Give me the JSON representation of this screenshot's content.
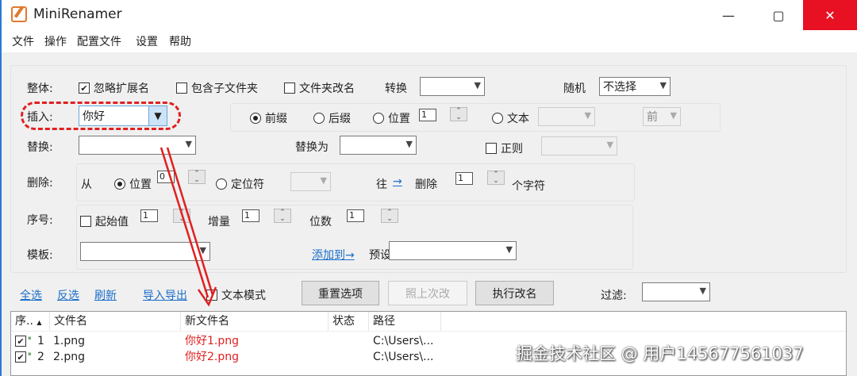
{
  "window": {
    "title": "MiniRenamer",
    "minimize": "—",
    "maximize": "▢",
    "close": "✕"
  },
  "menu": [
    "文件",
    "操作",
    "配置文件",
    "设置",
    "帮助"
  ],
  "whole": {
    "label": "整体:",
    "ignore_ext": "忽略扩展名",
    "ignore_ext_checked": true,
    "include_sub": "包含子文件夹",
    "folder_rename": "文件夹改名",
    "convert": "转换",
    "convert_value": "",
    "random": "随机",
    "random_value": "不选择"
  },
  "insert": {
    "label": "插入:",
    "value": "你好",
    "prefix": "前缀",
    "suffix": "后缀",
    "position": "位置",
    "position_value": "1",
    "text": "文本",
    "text_value": "",
    "side_value": "前"
  },
  "replace": {
    "label": "替换:",
    "value": "",
    "replace_with": "替换为",
    "replace_with_value": "",
    "regex": "正则"
  },
  "delete": {
    "label": "删除:",
    "from": "从",
    "position": "位置",
    "position_value": "0",
    "locator": "定位符",
    "towards": "往",
    "arrow": "→",
    "delete": "删除",
    "count": "1",
    "chars": "个字符"
  },
  "sequence": {
    "label": "序号:",
    "start": "起始值",
    "start_value": "1",
    "increment": "增量",
    "increment_value": "1",
    "digits": "位数",
    "digits_value": "1"
  },
  "template": {
    "label": "模板:",
    "value": "",
    "add_to": "添加到→",
    "preset": "预设",
    "preset_value": ""
  },
  "toolbar": {
    "select_all": "全选",
    "invert": "反选",
    "refresh": "刷新",
    "import_export": "导入导出",
    "text_mode": "文本模式",
    "reset": "重置选项",
    "repeat_last": "照上次改",
    "execute": "执行改名",
    "filter": "过滤:",
    "filter_value": ""
  },
  "list": {
    "columns": [
      "序..",
      "文件名",
      "新文件名",
      "状态",
      "路径"
    ],
    "rows": [
      {
        "no": "1",
        "name": "1.png",
        "new_name": "你好1.png",
        "status": "",
        "path": "C:\\Users\\..."
      },
      {
        "no": "2",
        "name": "2.png",
        "new_name": "你好2.png",
        "status": "",
        "path": "C:\\Users\\..."
      }
    ]
  },
  "watermark": "掘金技术社区 @ 用户145677561037",
  "colors": {
    "accent": "#2b78d4",
    "close": "#e81123",
    "highlight": "#e02020",
    "link": "#1a6ec9"
  }
}
